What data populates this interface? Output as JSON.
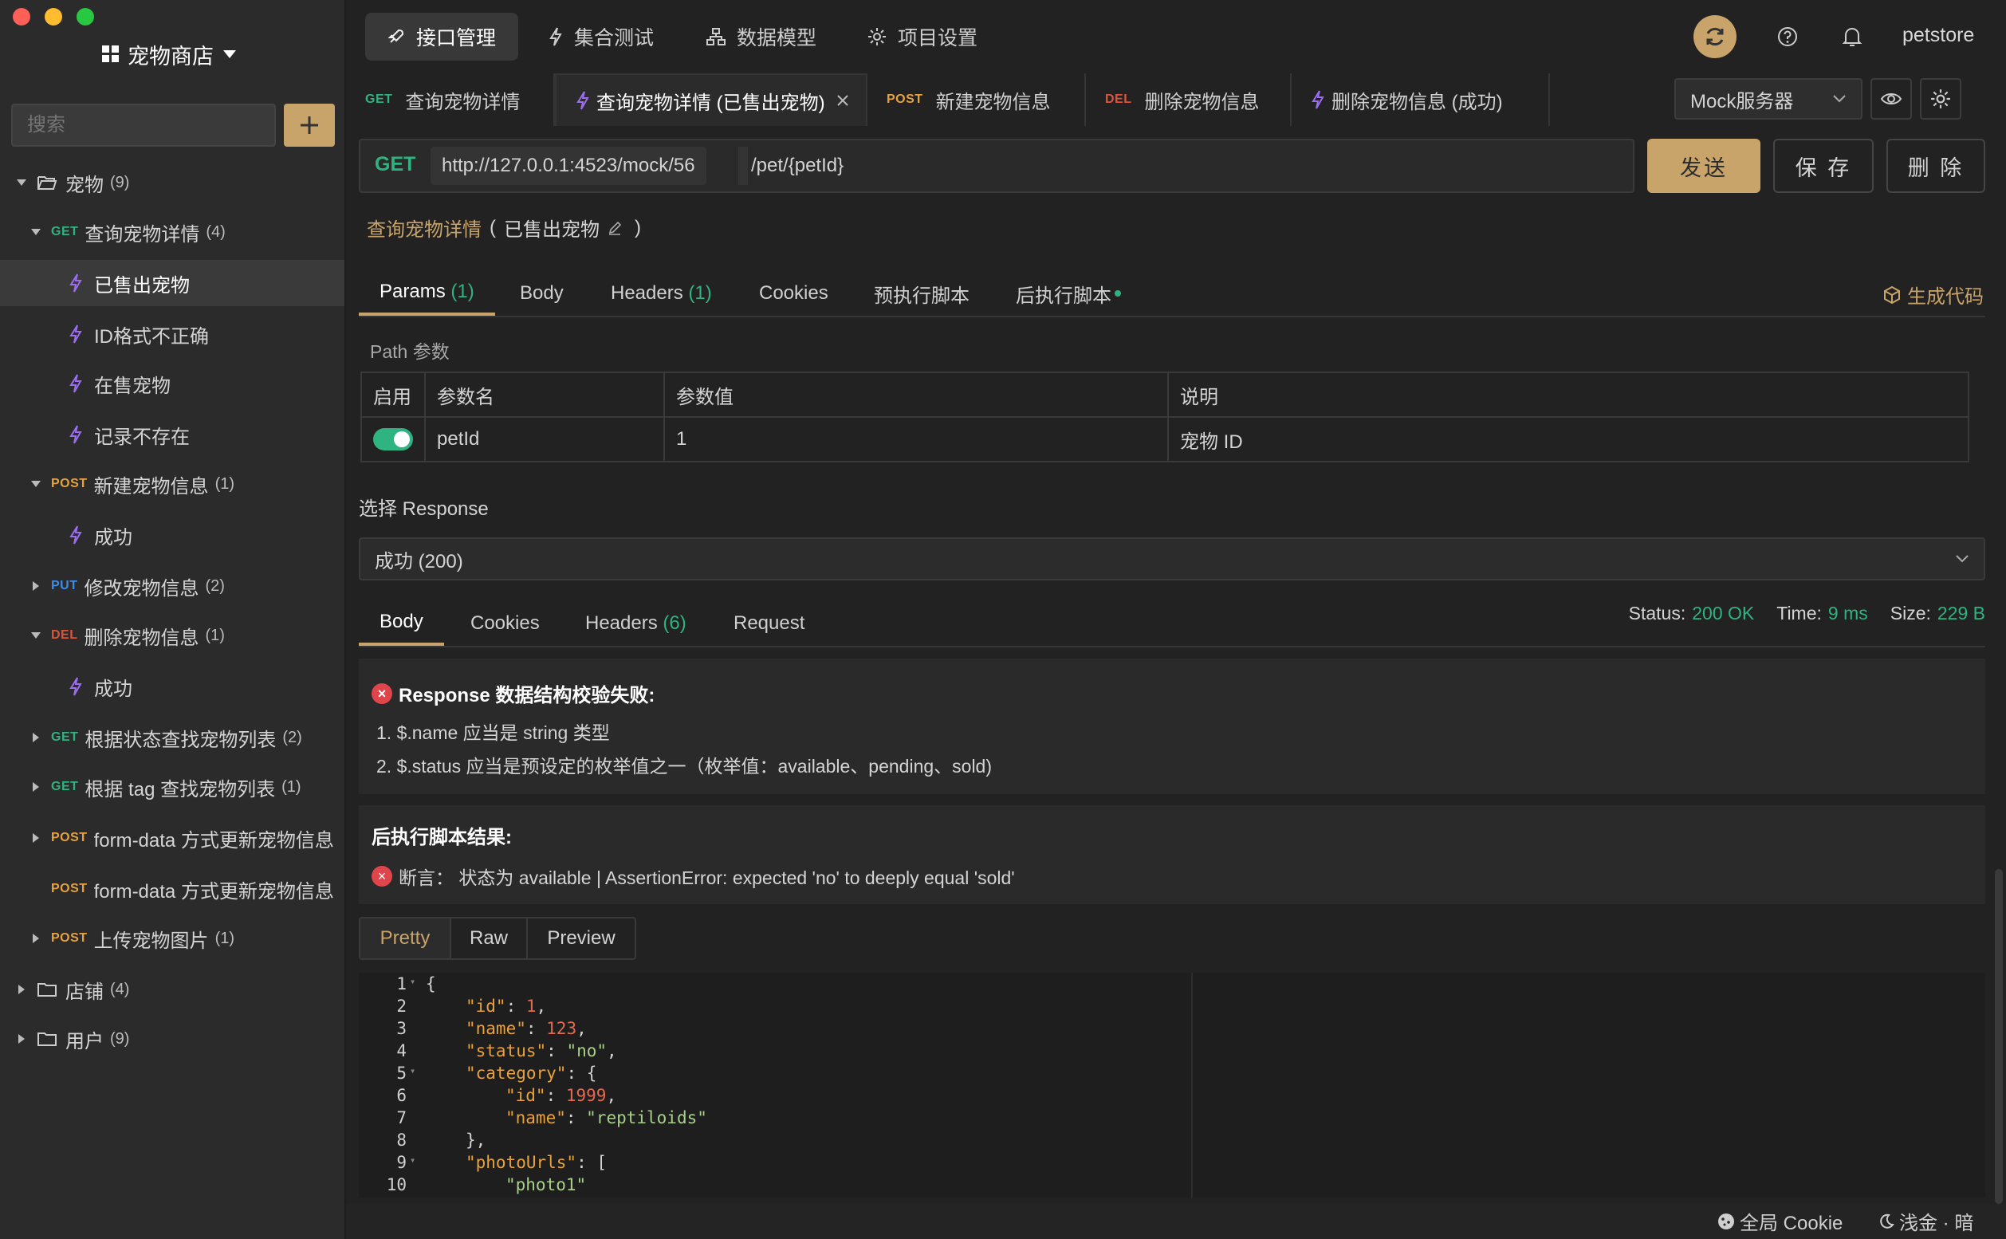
{
  "colors": {
    "accent": "#c9a46a",
    "get": "#2fb380",
    "post": "#e8a23d",
    "put": "#3d8bea",
    "del": "#e0533b",
    "error": "#e0454b"
  },
  "sidebar": {
    "project_title": "宠物商店",
    "search_placeholder": "搜索",
    "tree": [
      {
        "label": "宠物",
        "count": "(9)"
      },
      {
        "method": "GET",
        "label": "查询宠物详情",
        "count": "(4)"
      },
      {
        "label": "已售出宠物"
      },
      {
        "label": "ID格式不正确"
      },
      {
        "label": "在售宠物"
      },
      {
        "label": "记录不存在"
      },
      {
        "method": "POST",
        "label": "新建宠物信息",
        "count": "(1)"
      },
      {
        "label": "成功"
      },
      {
        "method": "PUT",
        "label": "修改宠物信息",
        "count": "(2)"
      },
      {
        "method": "DEL",
        "label": "删除宠物信息",
        "count": "(1)"
      },
      {
        "label": "成功"
      },
      {
        "method": "GET",
        "label": "根据状态查找宠物列表",
        "count": "(2)"
      },
      {
        "method": "GET",
        "label": "根据 tag 查找宠物列表",
        "count": "(1)"
      },
      {
        "method": "POST",
        "label": "form-data 方式更新宠物信息"
      },
      {
        "method": "POST",
        "label": "form-data 方式更新宠物信息"
      },
      {
        "method": "POST",
        "label": "上传宠物图片",
        "count": "(1)"
      },
      {
        "label": "店铺",
        "count": "(4)"
      },
      {
        "label": "用户",
        "count": "(9)"
      }
    ]
  },
  "topnav": {
    "items": [
      "接口管理",
      "集合测试",
      "数据模型",
      "项目设置"
    ],
    "user": "petstore"
  },
  "tabs": [
    {
      "method": "GET",
      "label": "查询宠物详情"
    },
    {
      "label": "查询宠物详情 (已售出宠物)"
    },
    {
      "method": "POST",
      "label": "新建宠物信息"
    },
    {
      "method": "DEL",
      "label": "删除宠物信息"
    },
    {
      "label": "删除宠物信息 (成功)"
    }
  ],
  "env_select": "Mock服务器",
  "request": {
    "method": "GET",
    "base_url": "http://127.0.0.1:4523/mock/56",
    "path": "/pet/{petId}",
    "send": "发送",
    "save": "保 存",
    "delete": "删 除",
    "breadcrumb_api": "查询宠物详情",
    "breadcrumb_open": "(",
    "breadcrumb_case": "已售出宠物",
    "breadcrumb_close": ")"
  },
  "param_tabs": {
    "params": "Params",
    "params_count": "(1)",
    "body": "Body",
    "headers": "Headers",
    "headers_count": "(1)",
    "cookies": "Cookies",
    "pre_script": "预执行脚本",
    "post_script": "后执行脚本",
    "gen_code": "生成代码"
  },
  "path_params": {
    "section": "Path 参数",
    "headers": [
      "启用",
      "参数名",
      "参数值",
      "说明"
    ],
    "row": {
      "enabled": true,
      "name": "petId",
      "value": "1",
      "desc": "宠物 ID"
    }
  },
  "response_select": {
    "label": "选择 Response",
    "value": "成功 (200)"
  },
  "response_tabs": {
    "body": "Body",
    "cookies": "Cookies",
    "headers": "Headers",
    "headers_count": "(6)",
    "request": "Request"
  },
  "status": {
    "status_label": "Status:",
    "status_value": "200 OK",
    "time_label": "Time:",
    "time_value": "9 ms",
    "size_label": "Size:",
    "size_value": "229 B"
  },
  "validation": {
    "title": "Response 数据结构校验失败:",
    "errors": [
      "1. $.name 应当是 string 类型",
      "2. $.status 应当是预设定的枚举值之一（枚举值：available、pending、sold)"
    ]
  },
  "post_script_result": {
    "title": "后执行脚本结果:",
    "assertion": "断言：  状态为 available | AssertionError: expected 'no' to deeply equal 'sold'"
  },
  "view_tabs": [
    "Pretty",
    "Raw",
    "Preview"
  ],
  "code_lines": [
    "1",
    "2",
    "3",
    "4",
    "5",
    "6",
    "7",
    "8",
    "9",
    "10"
  ],
  "json_body": {
    "id_key": "\"id\"",
    "id_val": "1",
    "name_key": "\"name\"",
    "name_val": "123",
    "status_key": "\"status\"",
    "status_val": "\"no\"",
    "category_key": "\"category\"",
    "cat_id_key": "\"id\"",
    "cat_id_val": "1999",
    "cat_name_key": "\"name\"",
    "cat_name_val": "\"reptiloids\"",
    "photo_key": "\"photoUrls\"",
    "photo_val": "\"photo1\""
  },
  "footer": {
    "cookie": "全局 Cookie",
    "theme": "浅金 · 暗"
  }
}
